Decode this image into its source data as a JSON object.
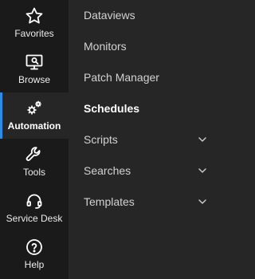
{
  "rail": {
    "items": [
      {
        "label": "Favorites",
        "icon": "star-icon"
      },
      {
        "label": "Browse",
        "icon": "monitor-search-icon"
      },
      {
        "label": "Automation",
        "icon": "gears-icon",
        "active": true
      },
      {
        "label": "Tools",
        "icon": "wrench-icon"
      },
      {
        "label": "Service Desk",
        "icon": "headset-icon"
      },
      {
        "label": "Help",
        "icon": "help-circle-icon"
      }
    ]
  },
  "menu": {
    "items": [
      {
        "label": "Dataviews"
      },
      {
        "label": "Monitors"
      },
      {
        "label": "Patch Manager"
      },
      {
        "label": "Schedules",
        "active": true
      },
      {
        "label": "Scripts",
        "expandable": true
      },
      {
        "label": "Searches",
        "expandable": true
      },
      {
        "label": "Templates",
        "expandable": true
      }
    ]
  },
  "colors": {
    "rail_bg": "#1a1a1a",
    "panel_bg": "#262626",
    "accent": "#2b8ee8",
    "text": "#d2d2d2"
  }
}
